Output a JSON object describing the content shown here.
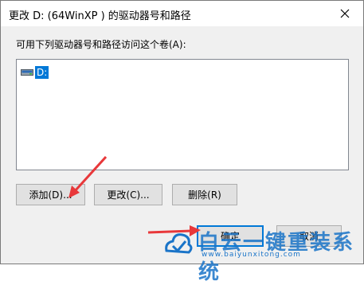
{
  "window": {
    "title": "更改 D: (64WinXP ) 的驱动器号和路径"
  },
  "dialog": {
    "prompt": "可用下列驱动器号和路径访问这个卷(A):",
    "list_items": [
      {
        "label": "D:",
        "icon": "drive-icon"
      }
    ]
  },
  "buttons": {
    "add": "添加(D)...",
    "change": "更改(C)...",
    "delete": "删除(R)",
    "ok": "确定",
    "cancel": "取消"
  },
  "watermark": {
    "text": "白云一键重装系统",
    "url": "www.baiyunxitong.com"
  },
  "colors": {
    "accent": "#0078d7",
    "arrow": "#e8383a",
    "watermark": "#1a74c8"
  }
}
